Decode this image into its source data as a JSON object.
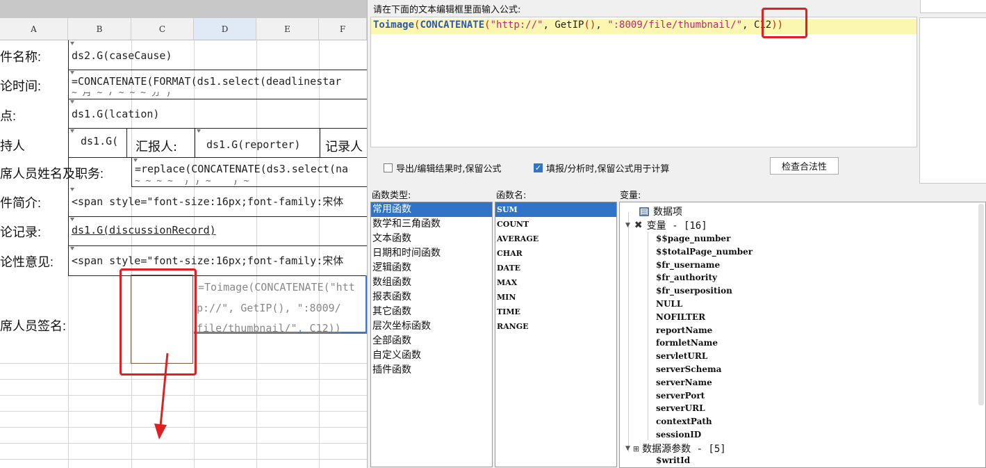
{
  "sheet": {
    "columns": [
      "A",
      "B",
      "C",
      "D",
      "E",
      "F"
    ],
    "rows": [
      {
        "label": "件名称:",
        "value": "ds2.G(caseCause)"
      },
      {
        "label": "论时间:",
        "value": "=CONCATENATE(FORMAT(ds1.select(deadlinestar"
      },
      {
        "label": "点:",
        "value": "ds1.G(lcation)"
      },
      {
        "label": "持人",
        "value": "ds1.G(",
        "extra_label": "汇报人:",
        "extra_value": "ds1.G(reporter)",
        "extra_label2": "记录人"
      },
      {
        "label": "席人员姓名及职务:",
        "value": "=replace(CONCATENATE(ds3.select(na"
      },
      {
        "label": "件简介:",
        "value": "<span style=\"font-size:16px;font-family:宋体"
      },
      {
        "label": "论记录:",
        "value": "ds1.G(discussionRecord)"
      },
      {
        "label": "论性意见:",
        "value": "<span style=\"font-size:16px;font-family:宋体"
      },
      {
        "label": "席人员签名:",
        "value": ""
      }
    ],
    "signature_formula": [
      "=Toimage(CONCATENATE(\"htt",
      "p://\", GetIP(), \":8009/",
      "file/thumbnail/\", C12))"
    ],
    "partial_text_row2": "~ 月 ~ 7 ~ ~ ~ 分\")",
    "partial_text_row5": "~ ~ ~ ~ \")\") ~ \"  \") ~ \"  \""
  },
  "dialog": {
    "prompt": "请在下面的文本编辑框里面输入公式:",
    "formula": {
      "fn_outer": "Toimage",
      "fn_concat": "CONCATENATE",
      "str1": "\"http://\"",
      "fn_ip": "GetIP",
      "str2": "\":8009/file/thumbnail/\"",
      "ref": "C12"
    },
    "options": {
      "keep_formula_export": {
        "label": "导出/编辑结果时,保留公式",
        "checked": false
      },
      "keep_formula_fill": {
        "label": "填报/分析时,保留公式用于计算",
        "checked": true
      }
    },
    "check_button": "检查合法性",
    "function_types_title": "函数类型:",
    "function_names_title": "函数名:",
    "variables_title": "变量:",
    "function_types": [
      "常用函数",
      "数学和三角函数",
      "文本函数",
      "日期和时间函数",
      "逻辑函数",
      "数组函数",
      "报表函数",
      "其它函数",
      "层次坐标函数",
      "全部函数",
      "自定义函数",
      "插件函数"
    ],
    "function_names": [
      "SUM",
      "COUNT",
      "AVERAGE",
      "CHAR",
      "DATE",
      "MAX",
      "MIN",
      "TIME",
      "RANGE"
    ],
    "variables": {
      "data_items": "数据项",
      "vars_group": "变量 - [16]",
      "vars": [
        "$$page_number",
        "$$totalPage_number",
        "$fr_username",
        "$fr_authority",
        "$fr_userposition",
        "NULL",
        "NOFILTER",
        "reportName",
        "formletName",
        "servletURL",
        "serverSchema",
        "serverName",
        "serverPort",
        "serverURL",
        "contextPath",
        "sessionID"
      ],
      "ds_params_group": "数据源参数 - [5]",
      "ds_params": [
        "$writId"
      ]
    }
  },
  "colors": {
    "highlight": "#fbf7b0",
    "selection": "#2f74c9",
    "annotation": "#e02020"
  }
}
